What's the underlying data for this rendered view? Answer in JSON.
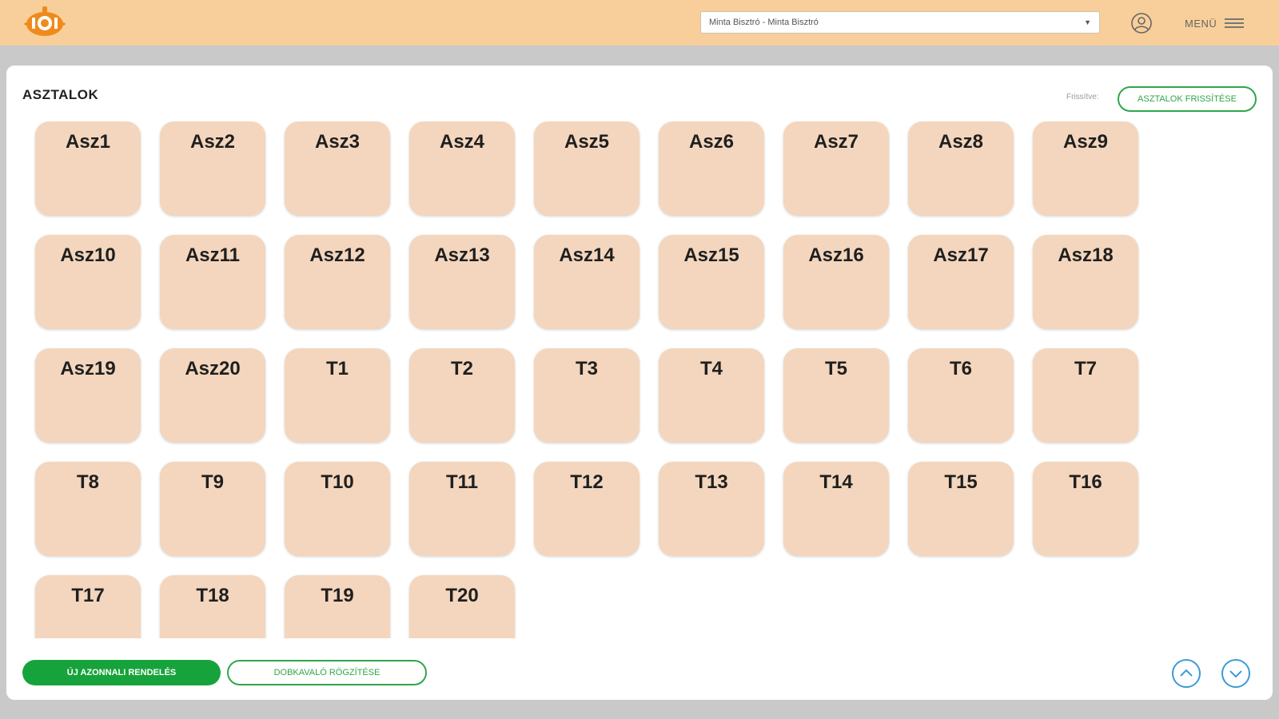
{
  "header": {
    "venue_select": {
      "value": "Minta Bisztró - Minta Bisztró"
    },
    "menu_label": "MENÜ",
    "brand_color": "#f8cf9a"
  },
  "main": {
    "title": "ASZTALOK",
    "refresh_hint": "Frissítve:",
    "refresh_button": "ASZTALOK FRISSÍTÉSE",
    "tables": [
      "Asz1",
      "Asz2",
      "Asz3",
      "Asz4",
      "Asz5",
      "Asz6",
      "Asz7",
      "Asz8",
      "Asz9",
      "Asz10",
      "Asz11",
      "Asz12",
      "Asz13",
      "Asz14",
      "Asz15",
      "Asz16",
      "Asz17",
      "Asz18",
      "Asz19",
      "Asz20",
      "T1",
      "T2",
      "T3",
      "T4",
      "T5",
      "T6",
      "T7",
      "T8",
      "T9",
      "T10",
      "T11",
      "T12",
      "T13",
      "T14",
      "T15",
      "T16",
      "T17",
      "T18",
      "T19",
      "T20"
    ],
    "tile_color": "#f3d6bd"
  },
  "footer": {
    "new_order_button": "ÚJ AZONNALI RENDELÉS",
    "takeaway_button": "DOBKAVALÓ RÖGZÍTÉSE",
    "scroll_up_icon": "chevron-up-icon",
    "scroll_down_icon": "chevron-down-icon",
    "accent_green": "#17a33b",
    "accent_blue": "#3d9ad6"
  }
}
